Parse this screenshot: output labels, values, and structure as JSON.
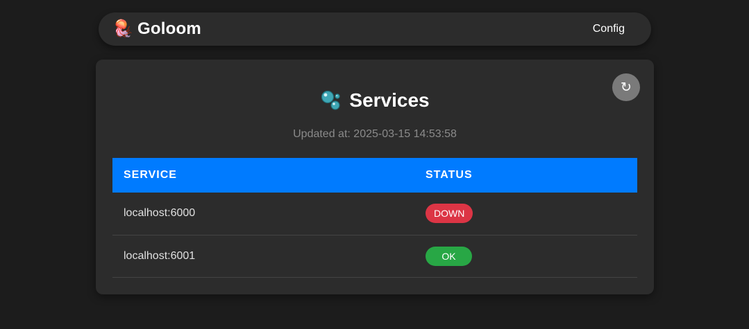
{
  "navbar": {
    "brand_icon": "🪼",
    "brand_name": "Goloom",
    "config_label": "Config"
  },
  "card": {
    "refresh_icon": "↻",
    "title_icon": "bubbles-icon",
    "title": "Services",
    "updated_label": "Updated at:",
    "updated_value": "2025-03-15 14:53:58"
  },
  "table": {
    "headers": [
      "SERVICE",
      "STATUS"
    ],
    "rows": [
      {
        "service": "localhost:6000",
        "status": "DOWN",
        "color": "#dc3545"
      },
      {
        "service": "localhost:6001",
        "status": "OK",
        "color": "#28a745"
      }
    ]
  },
  "colors": {
    "accent": "#007bff",
    "down": "#dc3545",
    "ok": "#28a745"
  }
}
